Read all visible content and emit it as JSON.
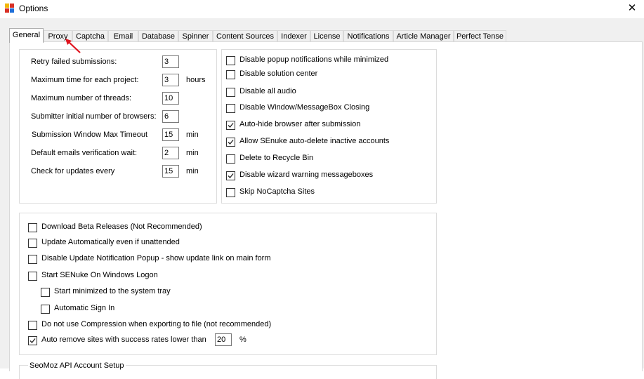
{
  "window": {
    "title": "Options"
  },
  "tabs": [
    "General",
    "Proxy",
    "Captcha",
    "Email",
    "Database",
    "Spinner",
    "Content Sources",
    "Indexer",
    "License",
    "Notifications",
    "Article Manager",
    "Perfect Tense"
  ],
  "settings": {
    "retry_label": "Retry failed submissions:",
    "retry_value": "3",
    "max_time_label": "Maximum time for each project:",
    "max_time_value": "3",
    "max_time_unit": "hours",
    "threads_label": "Maximum number of threads:",
    "threads_value": "10",
    "browsers_label": "Submitter initial number of browsers:",
    "browsers_value": "6",
    "timeout_label": "Submission Window Max Timeout",
    "timeout_value": "15",
    "timeout_unit": "min",
    "emails_label": "Default emails verification wait:",
    "emails_value": "2",
    "emails_unit": "min",
    "updates_label": "Check for updates every",
    "updates_value": "15",
    "updates_unit": "min"
  },
  "right_options": [
    {
      "label": "Disable popup notifications while minimized",
      "checked": false
    },
    {
      "label": "Disable solution center",
      "checked": false
    },
    {
      "label": "Disable all audio",
      "checked": false
    },
    {
      "label": "Disable Window/MessageBox Closing",
      "checked": false
    },
    {
      "label": "Auto-hide browser after submission",
      "checked": true
    },
    {
      "label": "Allow SEnuke auto-delete inactive accounts",
      "checked": true
    },
    {
      "label": "Delete to Recycle Bin",
      "checked": false
    },
    {
      "label": "Disable wizard warning messageboxes",
      "checked": true
    },
    {
      "label": "Skip NoCaptcha Sites",
      "checked": false
    }
  ],
  "lower_options": [
    {
      "label": "Download Beta Releases (Not Recommended)",
      "checked": false
    },
    {
      "label": "Update Automatically even if unattended",
      "checked": false
    },
    {
      "label": "Disable Update Notification Popup - show update link on main form",
      "checked": false
    },
    {
      "label": "Start SENuke On Windows Logon",
      "checked": false
    },
    {
      "label": "Start minimized to the system tray",
      "checked": false
    },
    {
      "label": "Automatic Sign In",
      "checked": false
    },
    {
      "label": "Do not use Compression when exporting to file (not recommended)",
      "checked": false
    },
    {
      "label": "Auto remove sites with success rates lower than",
      "checked": true
    }
  ],
  "auto_remove": {
    "value": "20",
    "unit": "%"
  },
  "seomoz": {
    "title": "SeoMoz API Account Setup"
  },
  "icons": {
    "app": "app-icon",
    "close": "close-icon",
    "check": "check-icon",
    "arrow": "red-arrow-icon"
  },
  "colors": {
    "arrow": "#e0141e",
    "window_bg": "#f0f0f0"
  }
}
